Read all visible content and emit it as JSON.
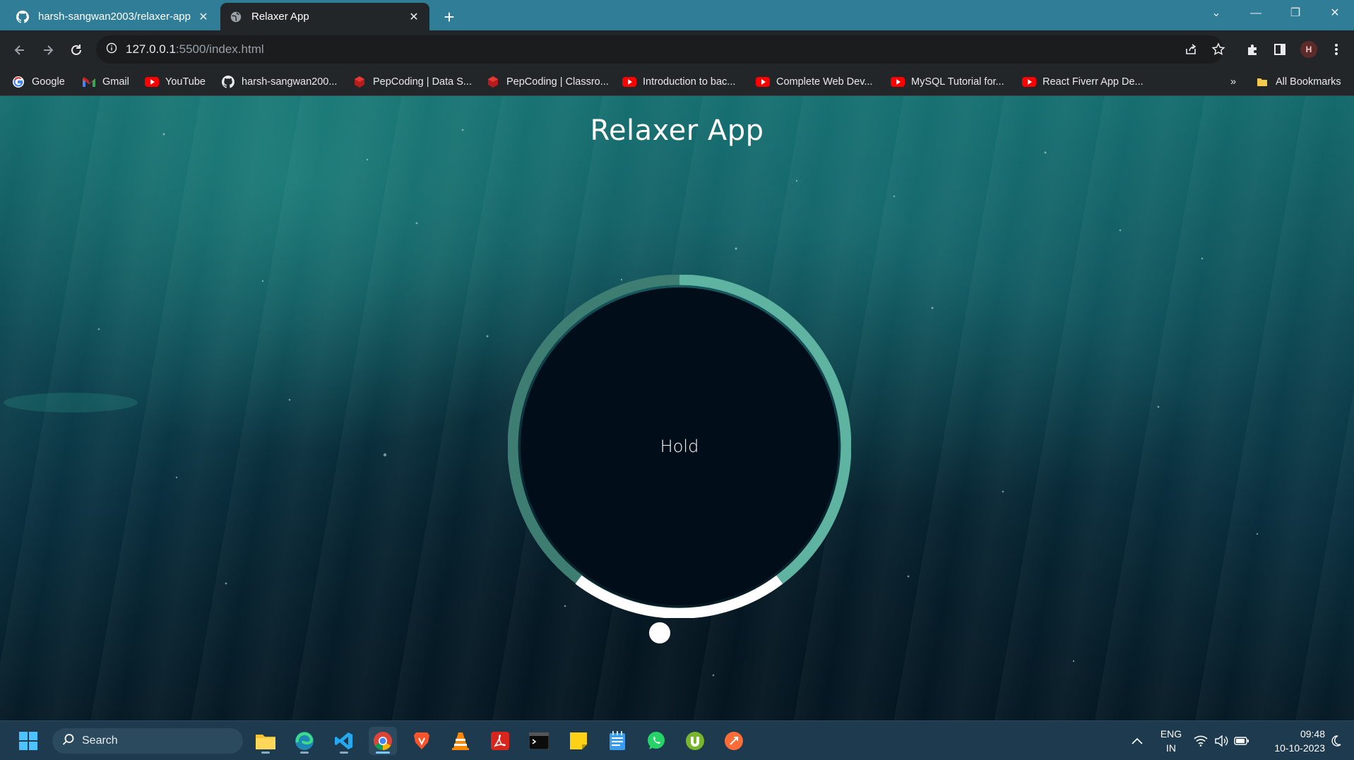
{
  "browser": {
    "tabs": [
      {
        "title": "harsh-sangwan2003/relaxer-app",
        "icon": "github-icon",
        "active": false
      },
      {
        "title": "Relaxer App",
        "icon": "globe-icon",
        "active": true
      }
    ],
    "address": {
      "host": "127.0.0.1",
      "path": ":5500/index.html"
    },
    "profile_initial": "H",
    "bookmarks": [
      {
        "label": "Google",
        "icon": "google-icon"
      },
      {
        "label": "Gmail",
        "icon": "gmail-icon"
      },
      {
        "label": "YouTube",
        "icon": "youtube-icon"
      },
      {
        "label": "harsh-sangwan200...",
        "icon": "github-icon"
      },
      {
        "label": "PepCoding | Data S...",
        "icon": "pepcoding-icon"
      },
      {
        "label": "PepCoding | Classro...",
        "icon": "pepcoding-icon"
      },
      {
        "label": "Introduction to bac...",
        "icon": "youtube-icon"
      },
      {
        "label": "Complete Web Dev...",
        "icon": "youtube-icon"
      },
      {
        "label": "MySQL Tutorial for...",
        "icon": "youtube-icon"
      },
      {
        "label": "React Fiverr App De...",
        "icon": "youtube-icon"
      }
    ],
    "bookmarks_overflow": "»",
    "all_bookmarks": "All Bookmarks"
  },
  "app": {
    "title": "Relaxer App",
    "status_text": "Hold",
    "colors": {
      "ring_breathe": "#5fb3a1",
      "ring_hold": "#ffffff",
      "ring_dim": "#3e7e72",
      "inner": "#010e19"
    }
  },
  "taskbar": {
    "search_placeholder": "Search",
    "apps": [
      "windows-start-icon",
      "file-explorer-icon",
      "edge-icon",
      "vscode-icon",
      "chrome-icon",
      "brave-icon",
      "vlc-icon",
      "acrobat-icon",
      "terminal-icon",
      "sticky-notes-icon",
      "notepad-icon",
      "whatsapp-icon",
      "utorrent-icon",
      "postman-icon"
    ],
    "lang_line1": "ENG",
    "lang_line2": "IN",
    "time": "09:48",
    "date": "10-10-2023"
  }
}
